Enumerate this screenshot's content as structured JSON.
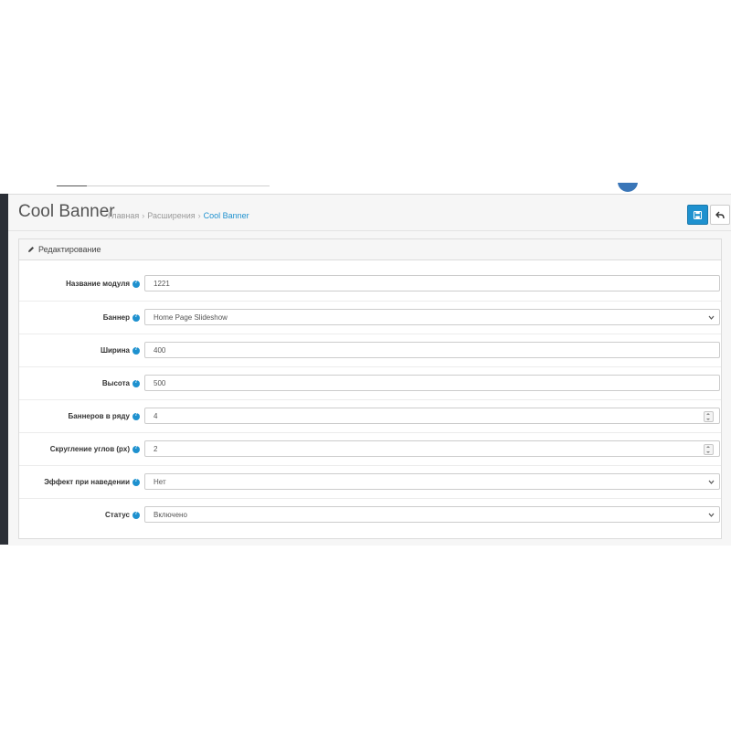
{
  "page": {
    "title": "Cool Banner",
    "breadcrumb": [
      "Главная",
      "Расширения",
      "Cool Banner"
    ]
  },
  "panel": {
    "heading": "Редактирование"
  },
  "form": {
    "name": {
      "label": "Название модуля",
      "value": "1221"
    },
    "banner": {
      "label": "Баннер",
      "value": "Home Page Slideshow"
    },
    "width": {
      "label": "Ширина",
      "value": "400"
    },
    "height": {
      "label": "Высота",
      "value": "500"
    },
    "per_row": {
      "label": "Баннеров в ряду",
      "value": "4"
    },
    "radius": {
      "label": "Скругление углов (px)",
      "value": "2"
    },
    "hover": {
      "label": "Эффект при наведении",
      "value": "Нет"
    },
    "status": {
      "label": "Статус",
      "value": "Включено"
    }
  },
  "colors": {
    "primary": "#1e91cf",
    "sidebar": "#2b2f36"
  },
  "icons": {
    "save": "save-icon",
    "back": "back-arrow-icon",
    "edit": "pencil-icon",
    "help": "question-circle-icon",
    "chevron": "chevron-down-icon"
  }
}
